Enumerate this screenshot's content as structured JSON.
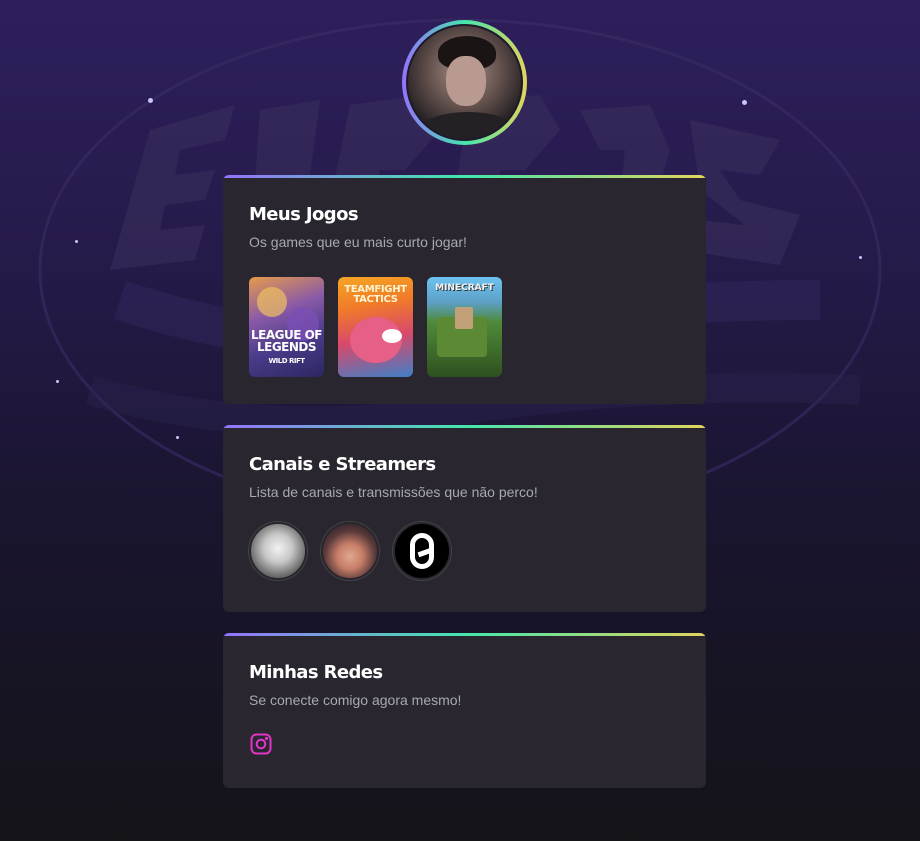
{
  "profile": {
    "avatar_icon": "profile-photo"
  },
  "sections": {
    "games": {
      "title": "Meus Jogos",
      "subtitle": "Os games que eu mais curto jogar!",
      "items": [
        {
          "icon": "league-of-legends-wild-rift-cover",
          "label_main": "LEAGUE OF LEGENDS",
          "label_sub": "WILD RIFT"
        },
        {
          "icon": "teamfight-tactics-cover",
          "label_main": "TEAMFIGHT TACTICS"
        },
        {
          "icon": "minecraft-cover",
          "label_main": "MINECRAFT"
        }
      ]
    },
    "channels": {
      "title": "Canais e Streamers",
      "subtitle": "Lista de canais e transmissões que não perco!",
      "items": [
        {
          "icon": "channel-avatar-1"
        },
        {
          "icon": "channel-avatar-2"
        },
        {
          "icon": "channel-avatar-3"
        }
      ]
    },
    "socials": {
      "title": "Minhas Redes",
      "subtitle": "Se conecte comigo agora mesmo!",
      "items": [
        {
          "icon": "instagram-icon",
          "color": "#e135c8"
        }
      ]
    }
  },
  "colors": {
    "gradient_start": "#9572fc",
    "gradient_mid": "#43e7ad",
    "gradient_end": "#e2d45c",
    "card_bg": "#29262f"
  }
}
